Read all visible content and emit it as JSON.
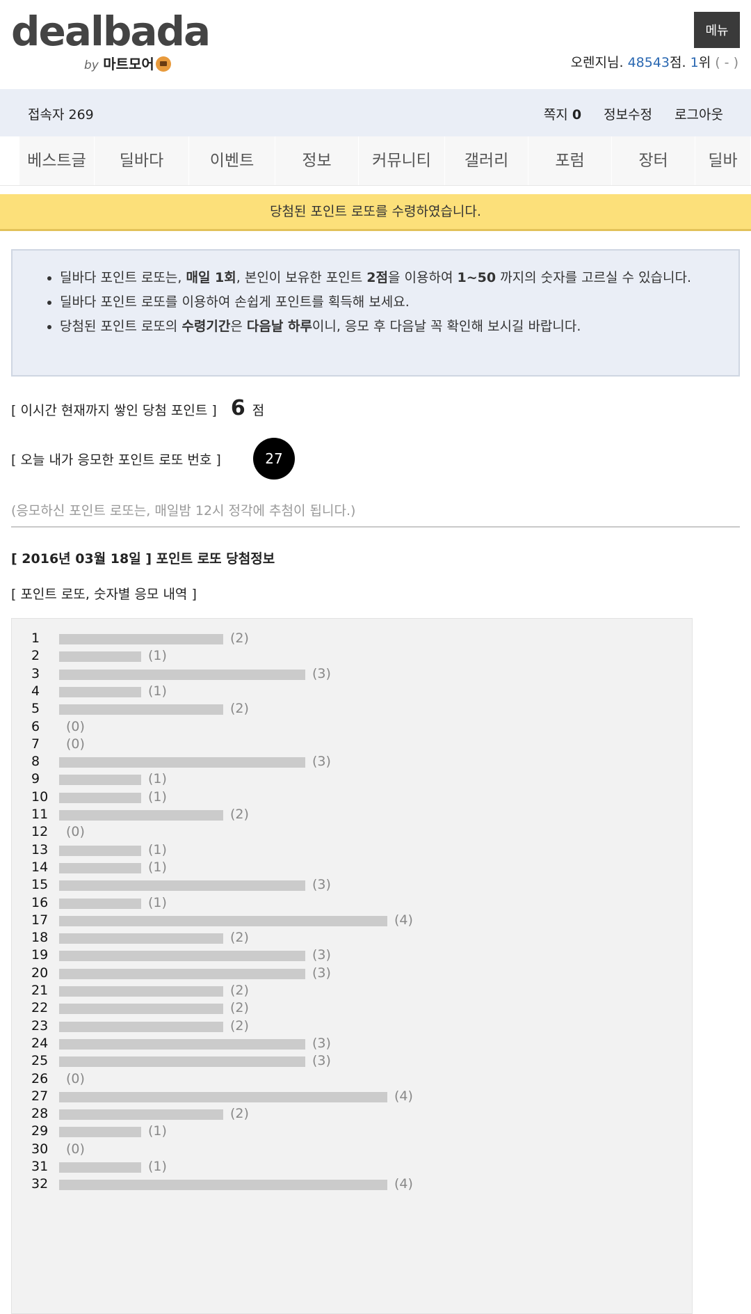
{
  "header": {
    "logo": "dealbada",
    "logo_by": "by",
    "logo_sub": "마트모어",
    "menu_label": "메뉴",
    "user": {
      "name": "오렌지님.",
      "points": "48543",
      "points_suffix": "점.",
      "rank": "1",
      "rank_suffix": "위",
      "rank_change": "( - )"
    }
  },
  "infobar": {
    "visitors": "접속자 269",
    "messages_label": "쪽지",
    "messages_count": "0",
    "edit_profile": "정보수정",
    "logout": "로그아웃"
  },
  "nav": {
    "items": [
      "베스트글",
      "딜바다",
      "이벤트",
      "정보",
      "커뮤니티",
      "갤러리",
      "포럼",
      "장터",
      "딜바"
    ]
  },
  "notice": "당첨된 포인트 로또를 수령하였습니다.",
  "rules": {
    "r1": {
      "a": "딜바다 포인트 로또는, ",
      "b": "매일 1회",
      "c": ", 본인이 보유한 포인트 ",
      "d": "2점",
      "e": "을 이용하여 ",
      "f": "1~50",
      "g": " 까지의 숫자를 고르실 수 있습니다."
    },
    "r2": "딜바다 포인트 로또를 이용하여 손쉽게 포인트를 획득해 보세요.",
    "r3": {
      "a": "당첨된 포인트 로또의 ",
      "b": "수령기간",
      "c": "은 ",
      "d": "다음날 하루",
      "e": "이니, 응모 후 다음날 꼭 확인해 보시길 바랍니다."
    }
  },
  "accumulated": {
    "label": "[ 이시간 현재까지 쌓인 당첨 포인트 ]",
    "value": "6",
    "unit": "점"
  },
  "my_entry": {
    "label": "[ 오늘 내가 응모한 포인트 로또 번호 ]",
    "number": "27"
  },
  "draw_note": "(응모하신 포인트 로또는, 매일밤 12시 정각에 추첨이 됩니다.)",
  "result_title": "[ 2016년 03월 18일 ] 포인트 로또 당첨정보",
  "entries_title": "[ 포인트 로또, 숫자별 응모 내역 ]",
  "chart_data": {
    "type": "bar",
    "orientation": "horizontal",
    "bar_color": "#cbcbcb",
    "categories": [
      "1",
      "2",
      "3",
      "4",
      "5",
      "6",
      "7",
      "8",
      "9",
      "10",
      "11",
      "12",
      "13",
      "14",
      "15",
      "16",
      "17",
      "18",
      "19",
      "20",
      "21",
      "22",
      "23",
      "24",
      "25",
      "26",
      "27",
      "28",
      "29",
      "30",
      "31",
      "32"
    ],
    "values": [
      2,
      1,
      3,
      1,
      2,
      0,
      0,
      3,
      1,
      1,
      2,
      0,
      1,
      1,
      3,
      1,
      4,
      2,
      3,
      3,
      2,
      2,
      2,
      3,
      3,
      0,
      4,
      2,
      1,
      0,
      1,
      4
    ]
  }
}
